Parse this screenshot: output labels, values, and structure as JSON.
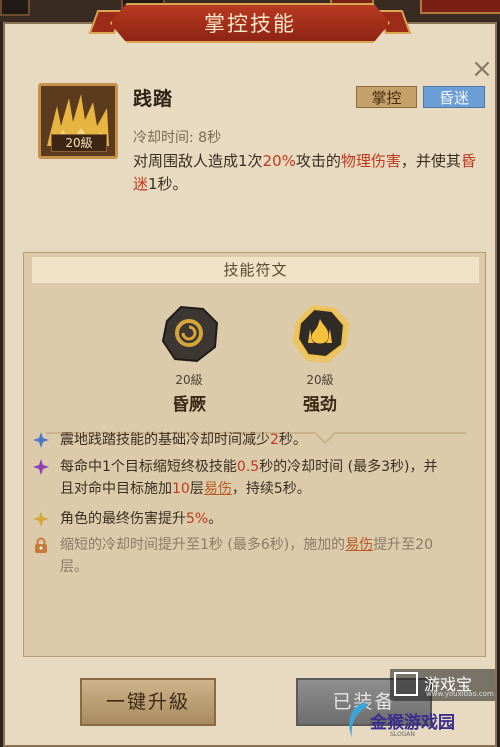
{
  "dialog": {
    "title": "掌控技能",
    "close_label": "×"
  },
  "skill": {
    "name": "践踏",
    "level": "20級",
    "tags": [
      "掌控",
      "昏迷"
    ],
    "cooldown": "冷却时间: 8秒",
    "desc_1": "对周围敌人造成1次",
    "desc_percent": "20%",
    "desc_2": "攻击的",
    "desc_dmg": "物理伤害",
    "desc_3": "，并使其",
    "desc_status": "昏迷",
    "desc_4": "1秒。"
  },
  "runes": {
    "header": "技能符文",
    "items": [
      {
        "level": "20級",
        "name": "昏厥"
      },
      {
        "level": "20級",
        "name": "强劲"
      }
    ]
  },
  "effects": [
    {
      "icon": "blue-star-icon",
      "color": "#4a79c6",
      "text_a": "震地践踏技能的基础冷却时间减少",
      "val": "2",
      "text_b": "秒。"
    },
    {
      "icon": "purple-star-icon",
      "color": "#8d3fbb",
      "p1": "每命中1个目标缩短终极技能",
      "v1": "0.5",
      "p2": "秒的冷却时间 (最多3秒)，并且对命中目标施加",
      "v2": "10",
      "p3": "层",
      "v3": "易伤",
      "p4": "，持续5秒。"
    },
    {
      "icon": "gold-star-icon",
      "color": "#d4a93a",
      "text_a": "角色的最终伤害提升",
      "val": "5%",
      "text_b": "。"
    },
    {
      "icon": "lock-icon",
      "color": "#c77a3a",
      "p1": "缩短的冷却时间提升至1秒 (最多6秒)，施加的",
      "v1": "易伤",
      "p2": "提升至20层。"
    }
  ],
  "buttons": {
    "upgrade": "一键升級",
    "equipped": "已装备"
  },
  "watermarks": {
    "site1": "游戏宝",
    "site1_url": "www.youxibao.com",
    "site2": "金猴游戏园",
    "site2_slogan": "SLOGAN"
  }
}
